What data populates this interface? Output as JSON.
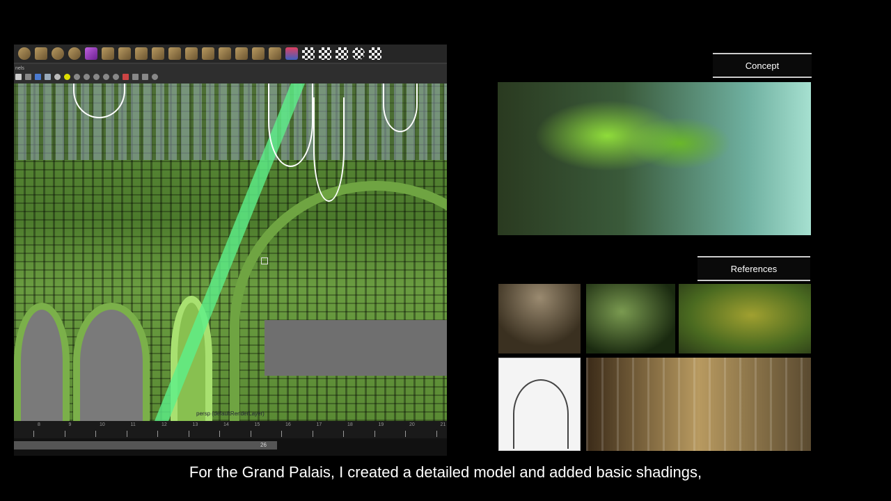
{
  "maya": {
    "panel_label": "nels",
    "viewport_label": "persp (defaultRenderLayer)",
    "timeline_ticks": [
      "8",
      "9",
      "10",
      "11",
      "12",
      "13",
      "14",
      "15",
      "16",
      "17",
      "18",
      "19",
      "20",
      "21"
    ],
    "current_frame": "26"
  },
  "right": {
    "concept_label": "Concept",
    "references_label": "References"
  },
  "subtitle": "For the Grand Palais, I created a detailed model and added basic shadings,"
}
